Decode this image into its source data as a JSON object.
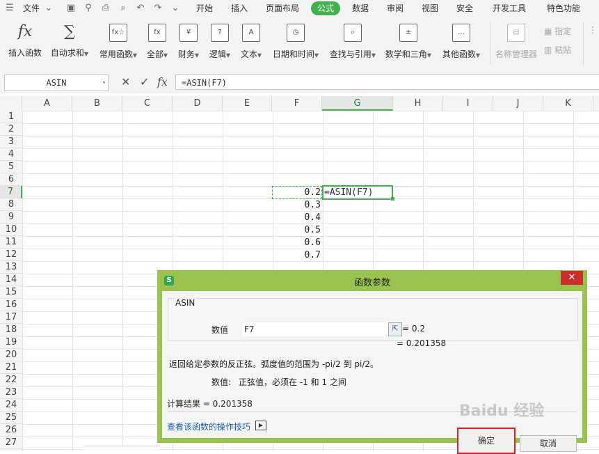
{
  "menubar": {
    "file": "文件",
    "tabs": [
      "开始",
      "插入",
      "页面布局",
      "公式",
      "数据",
      "审阅",
      "视图",
      "安全",
      "开发工具",
      "特色功能"
    ]
  },
  "ribbon": {
    "insert_function": "插入函数",
    "autosum": "自动求和",
    "common": "常用函数",
    "all": "全部",
    "finance": "财务",
    "logic": "逻辑",
    "text": "文本",
    "datetime": "日期和时间",
    "lookup": "查找与引用",
    "math": "数学和三角",
    "other": "其他函数",
    "name_mgr": "名称管理器",
    "define": "指定",
    "paste": "粘贴"
  },
  "formula_bar": {
    "name_box": "ASIN",
    "formula": "=ASIN(F7)"
  },
  "grid": {
    "columns": [
      "A",
      "B",
      "C",
      "D",
      "E",
      "F",
      "G",
      "H",
      "I",
      "J",
      "K"
    ],
    "rows": [
      "1",
      "2",
      "3",
      "4",
      "5",
      "6",
      "7",
      "8",
      "9",
      "10",
      "11",
      "12",
      "13",
      "14",
      "15",
      "16",
      "17",
      "18",
      "19",
      "20",
      "21",
      "22",
      "23",
      "24",
      "25",
      "26",
      "27"
    ],
    "f_values": [
      "0.2",
      "0.3",
      "0.4",
      "0.5",
      "0.6",
      "0.7"
    ],
    "g7": "=ASIN(F7)"
  },
  "dialog": {
    "title": "函数参数",
    "group_label": "ASIN",
    "arg_label": "数值",
    "arg_value": "F7",
    "arg_result": "= 0.2",
    "func_result": "= 0.201358",
    "description": "返回给定参数的反正弦。弧度值的范围为 -pi/2 到 pi/2。",
    "arg_desc_label": "数值:",
    "arg_desc": "正弦值，必须在 -1 和 1 之间",
    "calc_result": "计算结果 = 0.201358",
    "help_link": "查看该函数的操作技巧",
    "ok": "确定",
    "cancel": "取消"
  }
}
